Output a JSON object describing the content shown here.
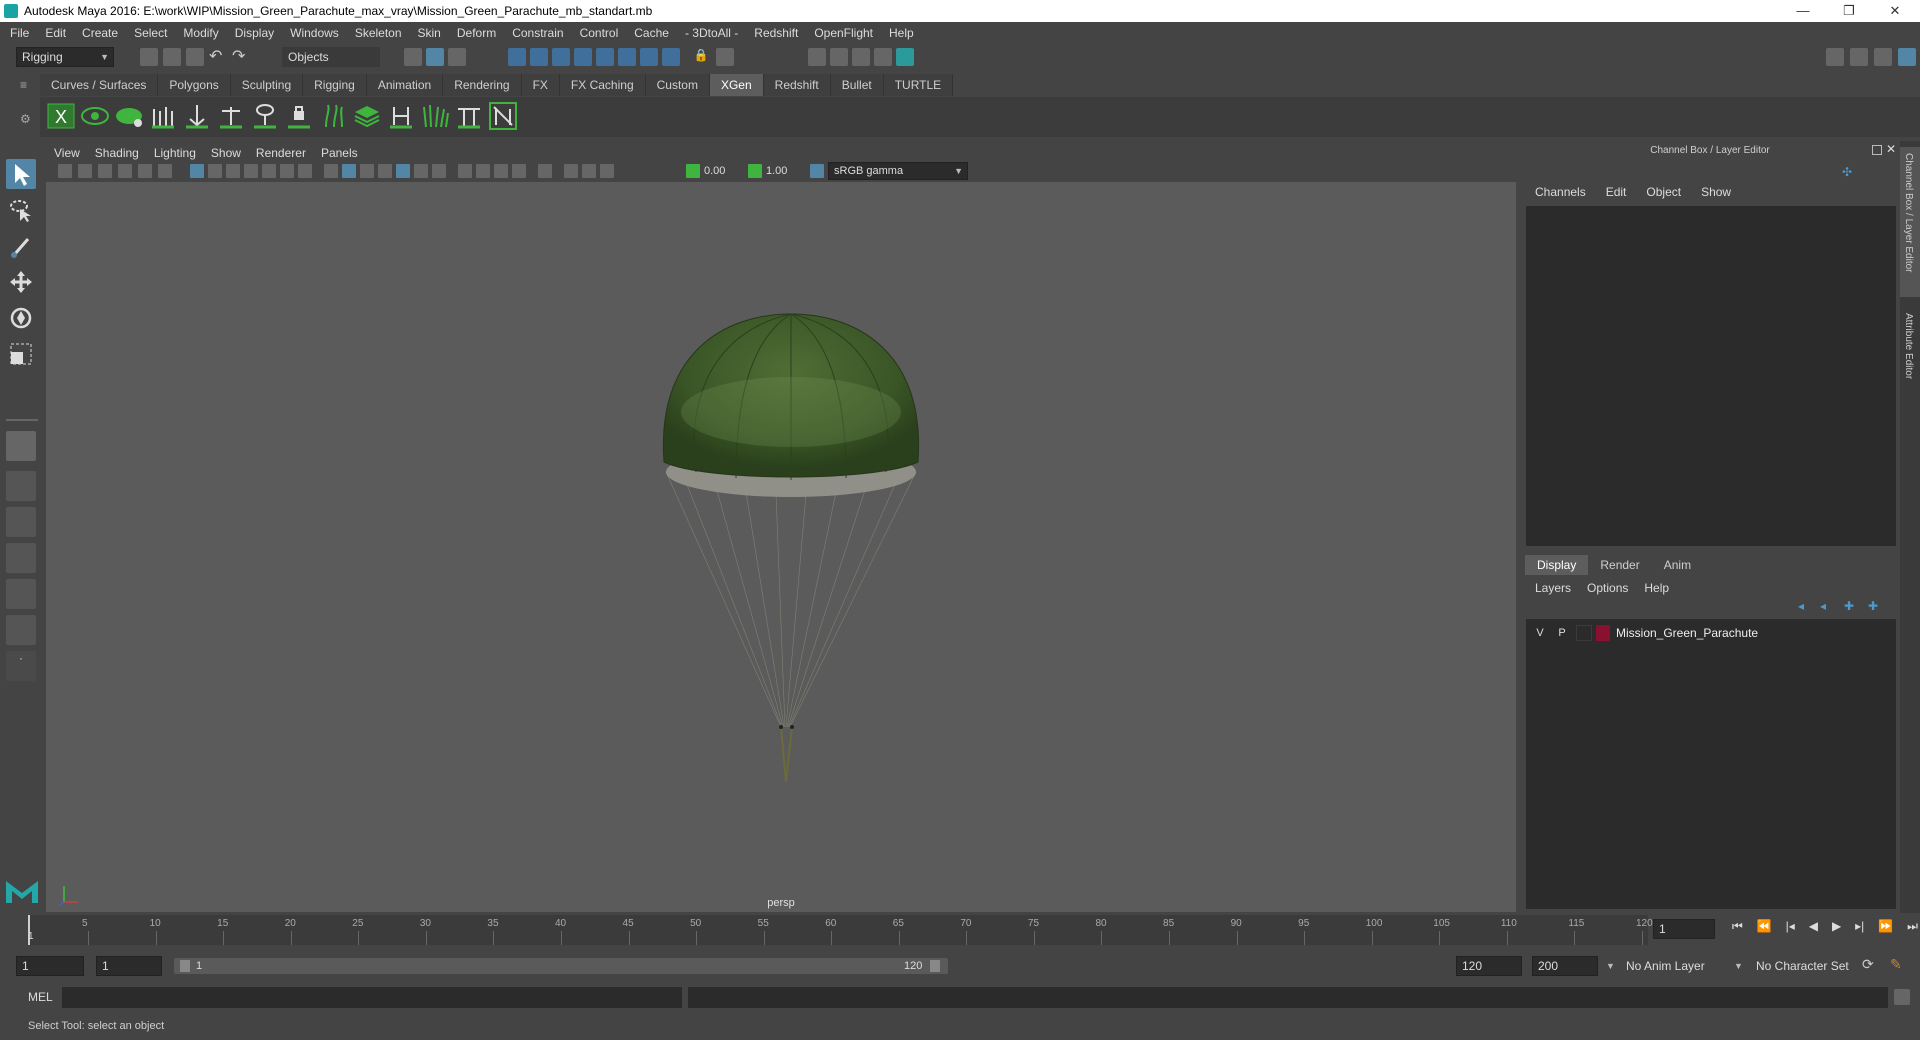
{
  "window": {
    "title": "Autodesk Maya 2016: E:\\work\\WIP\\Mission_Green_Parachute_max_vray\\Mission_Green_Parachute_mb_standart.mb",
    "minimize": "—",
    "restore": "❐",
    "close": "✕"
  },
  "menubar": [
    "File",
    "Edit",
    "Create",
    "Select",
    "Modify",
    "Display",
    "Windows",
    "Skeleton",
    "Skin",
    "Deform",
    "Constrain",
    "Control",
    "Cache",
    "- 3DtoAll -",
    "Redshift",
    "OpenFlight",
    "Help"
  ],
  "statusline": {
    "menuset": "Rigging",
    "selection_mode": "Objects"
  },
  "shelf": {
    "tabs": [
      "Curves / Surfaces",
      "Polygons",
      "Sculpting",
      "Rigging",
      "Animation",
      "Rendering",
      "FX",
      "FX Caching",
      "Custom",
      "XGen",
      "Redshift",
      "Bullet",
      "TURTLE"
    ],
    "active_tab": "XGen"
  },
  "viewport": {
    "menu": [
      "View",
      "Shading",
      "Lighting",
      "Show",
      "Renderer",
      "Panels"
    ],
    "exposure": "0.00",
    "gamma": "1.00",
    "color_space": "sRGB gamma",
    "camera": "persp"
  },
  "channel_box": {
    "header": "Channel Box / Layer Editor",
    "menu": [
      "Channels",
      "Edit",
      "Object",
      "Show"
    ]
  },
  "layer_editor": {
    "tabs": [
      "Display",
      "Render",
      "Anim"
    ],
    "active_tab": "Display",
    "menu": [
      "Layers",
      "Options",
      "Help"
    ],
    "layers": [
      {
        "v": "V",
        "p": "P",
        "name": "Mission_Green_Parachute",
        "color": "#8a1030"
      }
    ]
  },
  "side_tabs": [
    "Channel Box / Layer Editor",
    "Attribute Editor"
  ],
  "timeline": {
    "ticks": [
      "5",
      "10",
      "15",
      "20",
      "25",
      "30",
      "35",
      "40",
      "45",
      "50",
      "55",
      "60",
      "65",
      "70",
      "75",
      "80",
      "85",
      "90",
      "95",
      "100",
      "105",
      "110",
      "115",
      "120"
    ],
    "start_marker": "1",
    "current_frame": "1"
  },
  "range": {
    "start": "1",
    "playback_start": "1",
    "slider_start": "1",
    "slider_end": "120",
    "playback_end": "120",
    "end": "200",
    "anim_layer": "No Anim Layer",
    "character_set": "No Character Set"
  },
  "command": {
    "label": "MEL"
  },
  "help_line": "Select Tool: select an object",
  "colors": {
    "accent": "#5285a6",
    "xgen_green": "#3fb53f",
    "parachute": "#3e5a2a",
    "layer_color": "#8a1030"
  }
}
